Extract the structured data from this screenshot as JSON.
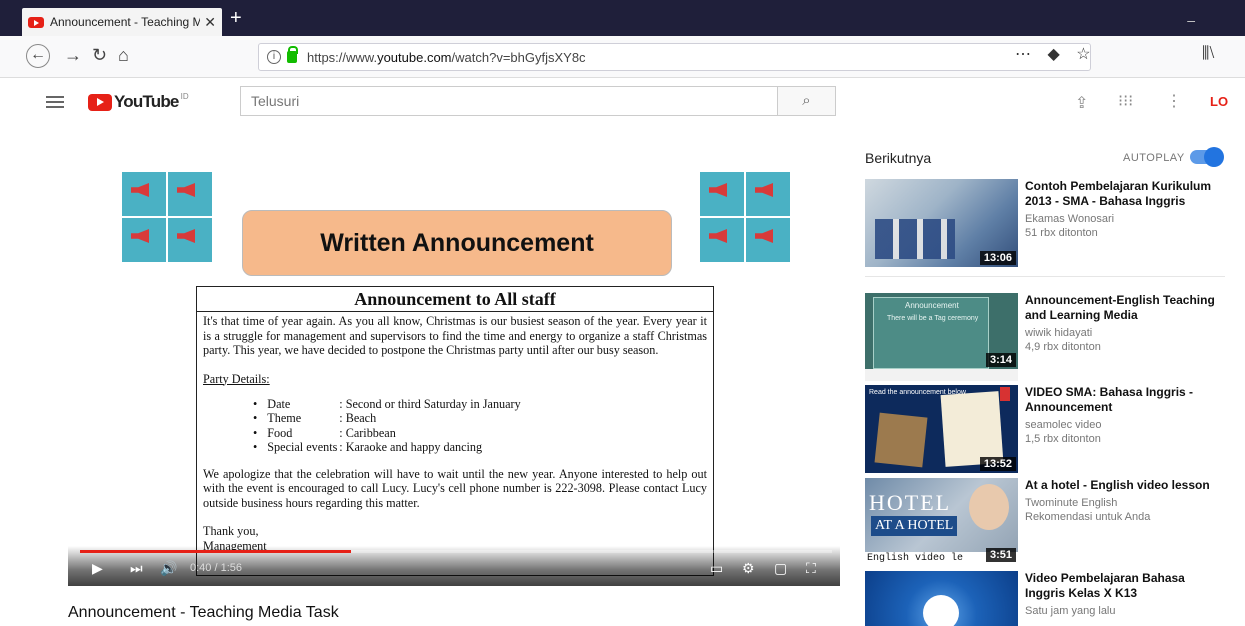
{
  "browser": {
    "tab_title": "Announcement - Teaching Me",
    "tab_close": "✕",
    "new_tab": "+",
    "minimize": "–",
    "url_prefix": "https://www.",
    "url_host": "youtube.com",
    "url_path": "/watch?v=bhGyfjsXY8c",
    "actions": "⋯ ◆ ☆",
    "library": "⫼⧵"
  },
  "youtube": {
    "logo_word": "YouTube",
    "region": "ID",
    "search_placeholder": "Telusuri",
    "search_icon": "⌕",
    "login": "LO"
  },
  "video": {
    "banner_text": "Written Announcement",
    "doc_title": "Announcement to All staff",
    "para1": "It's that time of year again. As you all know, Christmas is our busiest season of the year. Every year it is a struggle for management and supervisors to find the time and energy to organize a staff Christmas party. This year, we have decided to postpone the Christmas party until after our busy season.",
    "party_heading": "Party Details:",
    "details": [
      {
        "key": "Date",
        "value": ": Second or third Saturday in January"
      },
      {
        "key": "Theme",
        "value": ": Beach"
      },
      {
        "key": "Food",
        "value": ": Caribbean"
      },
      {
        "key": "Special events",
        "value": ": Karaoke and happy dancing"
      }
    ],
    "para2": "We apologize that the celebration will have to wait until the new year. Anyone interested to help out with the event is encouraged to call Lucy. Lucy's cell phone number is 222-3098. Please contact Lucy outside business hours regarding this matter.",
    "signoff1": "Thank you,",
    "signoff2": "Management",
    "time_current": "0:40",
    "time_total": "1:56",
    "time_display": "0:40 / 1:56",
    "progress_fraction": 0.36,
    "title": "Announcement - Teaching Media Task"
  },
  "sidebar": {
    "next_label": "Berikutnya",
    "autoplay_label": "AUTOPLAY",
    "autoplay_on": true,
    "items": [
      {
        "title": "Contoh Pembelajaran Kurikulum 2013 - SMA - Bahasa Inggris",
        "channel": "Ekamas Wonosari",
        "views": "51 rbx ditonton",
        "duration": "13:06"
      },
      {
        "title": "Announcement-English Teaching and Learning Media",
        "channel": "wiwik hidayati",
        "views": "4,9 rbx ditonton",
        "duration": "3:14",
        "thumb_caption1": "Announcement",
        "thumb_caption2": "There will be a Tag ceremony"
      },
      {
        "title": "VIDEO SMA: Bahasa Inggris - Announcement",
        "channel": "seamolec video",
        "views": "1,5 rbx ditonton",
        "duration": "13:52",
        "thumb_caption1": "Read the announcement below"
      },
      {
        "title": "At a hotel - English video lesson",
        "channel": "Twominute English",
        "views": "Rekomendasi untuk Anda",
        "duration": "3:51",
        "thumb_caption1": "HOTEL",
        "thumb_caption2": "AT A HOTEL",
        "thumb_caption3": "English video le"
      },
      {
        "title": "Video Pembelajaran Bahasa Inggris Kelas X K13",
        "channel": "Satu jam yang lalu",
        "views": "",
        "duration": ""
      }
    ]
  }
}
